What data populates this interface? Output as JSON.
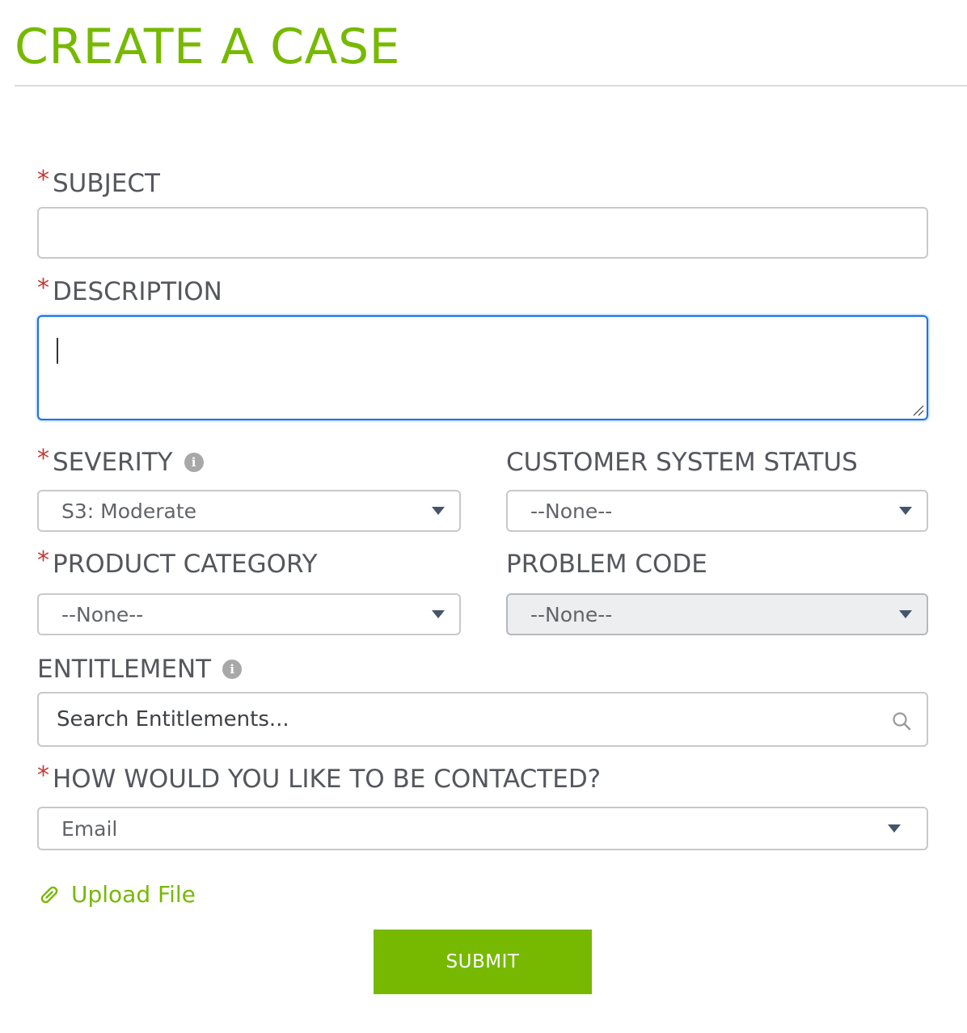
{
  "page": {
    "title": "CREATE A CASE"
  },
  "form": {
    "required_marker": "*",
    "subject": {
      "label": "SUBJECT",
      "value": ""
    },
    "description": {
      "label": "DESCRIPTION",
      "value": ""
    },
    "severity": {
      "label": "SEVERITY",
      "selected": "S3: Moderate",
      "info_icon": "info-icon"
    },
    "customer_system_status": {
      "label": "CUSTOMER SYSTEM STATUS",
      "selected": "--None--"
    },
    "product_category": {
      "label": "PRODUCT CATEGORY",
      "selected": "--None--"
    },
    "problem_code": {
      "label": "PROBLEM CODE",
      "selected": "--None--",
      "disabled": true
    },
    "entitlement": {
      "label": "ENTITLEMENT",
      "placeholder": "Search Entitlements...",
      "info_icon": "info-icon",
      "search_icon": "search-icon"
    },
    "contact_method": {
      "label": "HOW WOULD YOU LIKE TO BE CONTACTED?",
      "selected": "Email"
    },
    "upload": {
      "label": "Upload File",
      "icon": "paperclip-icon"
    },
    "submit": {
      "label": "SUBMIT"
    }
  },
  "colors": {
    "accent": "#76b900",
    "required": "#c23934",
    "focus": "#1b73e8",
    "text": "#54575c"
  }
}
